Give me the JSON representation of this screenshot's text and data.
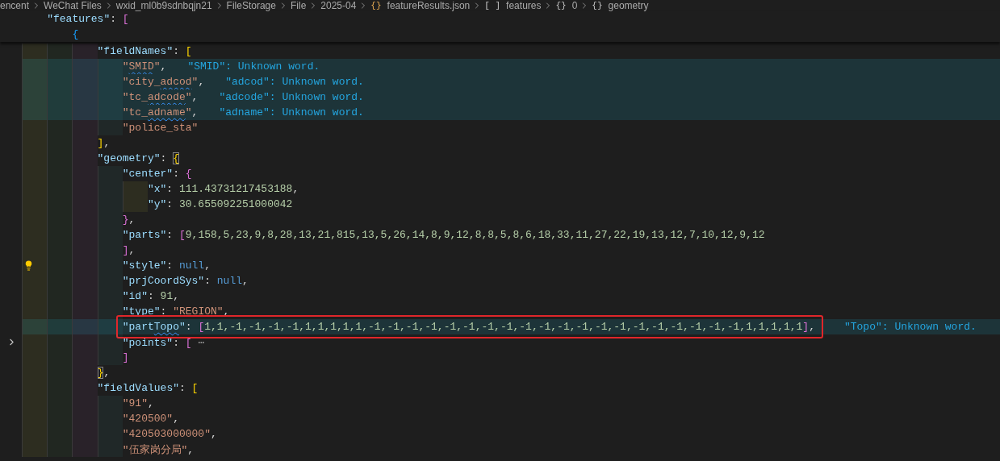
{
  "breadcrumb": [
    {
      "label": "encent",
      "kind": "folder"
    },
    {
      "label": "WeChat Files",
      "kind": "folder"
    },
    {
      "label": "wxid_ml0b9sdnbqjn21",
      "kind": "folder"
    },
    {
      "label": "FileStorage",
      "kind": "folder"
    },
    {
      "label": "File",
      "kind": "folder"
    },
    {
      "label": "2025-04",
      "kind": "folder"
    },
    {
      "label": "featureResults.json",
      "kind": "file",
      "icon": "{}"
    },
    {
      "label": "features",
      "kind": "symbol",
      "icon": "[ ]"
    },
    {
      "label": "0",
      "kind": "symbol",
      "icon": "{}"
    },
    {
      "label": "geometry",
      "kind": "symbol",
      "icon": "{}"
    }
  ],
  "sticky_lines": [
    {
      "tokens": [
        {
          "kind": "key",
          "text": "    \"features\""
        },
        {
          "kind": "punct",
          "text": ": "
        },
        {
          "kind": "bracket-pink",
          "text": "["
        }
      ]
    },
    {
      "tokens": [
        {
          "kind": "bracket-blue",
          "text": "        {"
        }
      ]
    }
  ],
  "lines": [
    {
      "highlighted": false,
      "boxed": false,
      "tokens": [
        {
          "kind": "key",
          "text": "            \"fieldNames\""
        },
        {
          "kind": "punct",
          "text": ": "
        },
        {
          "kind": "bracket-gold",
          "text": "["
        }
      ]
    },
    {
      "highlighted": true,
      "boxed": false,
      "annotation": "\"SMID\": Unknown word.",
      "tokens": [
        {
          "kind": "string",
          "text": "                \""
        },
        {
          "kind": "string-flagged",
          "text": "SMID"
        },
        {
          "kind": "string",
          "text": "\""
        },
        {
          "kind": "punct",
          "text": ","
        }
      ]
    },
    {
      "highlighted": true,
      "boxed": false,
      "annotation": "\"adcod\": Unknown word.",
      "tokens": [
        {
          "kind": "string",
          "text": "                \"city_"
        },
        {
          "kind": "string-flagged",
          "text": "adcod"
        },
        {
          "kind": "string",
          "text": "\""
        },
        {
          "kind": "punct",
          "text": ","
        }
      ]
    },
    {
      "highlighted": true,
      "boxed": false,
      "annotation": "\"adcode\": Unknown word.",
      "tokens": [
        {
          "kind": "string",
          "text": "                \"tc_"
        },
        {
          "kind": "string-flagged",
          "text": "adcode"
        },
        {
          "kind": "string",
          "text": "\""
        },
        {
          "kind": "punct",
          "text": ","
        }
      ]
    },
    {
      "highlighted": true,
      "boxed": false,
      "annotation": "\"adname\": Unknown word.",
      "tokens": [
        {
          "kind": "string",
          "text": "                \"tc_"
        },
        {
          "kind": "string-flagged",
          "text": "adname"
        },
        {
          "kind": "string",
          "text": "\""
        },
        {
          "kind": "punct",
          "text": ","
        }
      ]
    },
    {
      "highlighted": false,
      "boxed": false,
      "tokens": [
        {
          "kind": "string",
          "text": "                \"police_sta\""
        }
      ]
    },
    {
      "highlighted": false,
      "boxed": false,
      "tokens": [
        {
          "kind": "bracket-gold",
          "text": "            ]"
        },
        {
          "kind": "punct",
          "text": ","
        }
      ]
    },
    {
      "highlighted": false,
      "boxed": false,
      "tokens": [
        {
          "kind": "key",
          "text": "            \"geometry\""
        },
        {
          "kind": "punct",
          "text": ": "
        },
        {
          "kind": "bracket-gold-matched",
          "text": "{"
        }
      ]
    },
    {
      "highlighted": false,
      "boxed": false,
      "tokens": [
        {
          "kind": "key",
          "text": "                \"center\""
        },
        {
          "kind": "punct",
          "text": ": "
        },
        {
          "kind": "bracket-pink",
          "text": "{"
        }
      ]
    },
    {
      "highlighted": false,
      "boxed": false,
      "tokens": [
        {
          "kind": "key",
          "text": "                    \"x\""
        },
        {
          "kind": "punct",
          "text": ": "
        },
        {
          "kind": "number",
          "text": "111.43731217453188"
        },
        {
          "kind": "punct",
          "text": ","
        }
      ]
    },
    {
      "highlighted": false,
      "boxed": false,
      "tokens": [
        {
          "kind": "key",
          "text": "                    \"y\""
        },
        {
          "kind": "punct",
          "text": ": "
        },
        {
          "kind": "number",
          "text": "30.655092251000042"
        }
      ]
    },
    {
      "highlighted": false,
      "boxed": false,
      "tokens": [
        {
          "kind": "bracket-pink",
          "text": "                }"
        },
        {
          "kind": "punct",
          "text": ","
        }
      ]
    },
    {
      "highlighted": false,
      "boxed": false,
      "tokens": [
        {
          "kind": "key",
          "text": "                \"parts\""
        },
        {
          "kind": "punct",
          "text": ": "
        },
        {
          "kind": "bracket-pink",
          "text": "["
        },
        {
          "kind": "number",
          "text": "9,158,5,23,9,8,28,13,21,815,13,5,26,14,8,9,12,8,8,5,8,6,18,33,11,27,22,19,13,12,7,10,12,9,12"
        }
      ]
    },
    {
      "highlighted": false,
      "boxed": false,
      "tokens": [
        {
          "kind": "bracket-pink",
          "text": "                ]"
        },
        {
          "kind": "punct",
          "text": ","
        }
      ]
    },
    {
      "highlighted": false,
      "boxed": false,
      "kind": "lightbulb",
      "tokens": [
        {
          "kind": "key",
          "text": "                \"style\""
        },
        {
          "kind": "punct",
          "text": ": "
        },
        {
          "kind": "keyword",
          "text": "null"
        },
        {
          "kind": "punct",
          "text": ","
        }
      ]
    },
    {
      "highlighted": false,
      "boxed": false,
      "tokens": [
        {
          "kind": "key",
          "text": "                \"prjCoordSys\""
        },
        {
          "kind": "punct",
          "text": ": "
        },
        {
          "kind": "keyword",
          "text": "null"
        },
        {
          "kind": "punct",
          "text": ","
        }
      ]
    },
    {
      "highlighted": false,
      "boxed": false,
      "tokens": [
        {
          "kind": "key",
          "text": "                \"id\""
        },
        {
          "kind": "punct",
          "text": ": "
        },
        {
          "kind": "number",
          "text": "91"
        },
        {
          "kind": "punct",
          "text": ","
        }
      ]
    },
    {
      "highlighted": false,
      "boxed": false,
      "tokens": [
        {
          "kind": "key",
          "text": "                \"type\""
        },
        {
          "kind": "punct",
          "text": ": "
        },
        {
          "kind": "string",
          "text": "\"REGION\""
        },
        {
          "kind": "punct",
          "text": ","
        }
      ]
    },
    {
      "highlighted": true,
      "boxed": true,
      "annotation": "\"Topo\": Unknown word.",
      "tokens": [
        {
          "kind": "key",
          "text": "                \"part"
        },
        {
          "kind": "key-flagged",
          "text": "Topo"
        },
        {
          "kind": "key",
          "text": "\""
        },
        {
          "kind": "punct",
          "text": ": "
        },
        {
          "kind": "bracket-pink",
          "text": "["
        },
        {
          "kind": "number",
          "text": "1,1,-1,-1,-1,-1,1,1,1,1,1,-1,-1,-1,-1,-1,-1,-1,-1,-1,-1,-1,-1,-1,-1,-1,-1,-1,-1,-1,-1,1,1,1,1,1"
        },
        {
          "kind": "bracket-pink",
          "text": "]"
        },
        {
          "kind": "punct",
          "text": ","
        }
      ]
    },
    {
      "highlighted": false,
      "boxed": false,
      "kind": "folded",
      "tokens": [
        {
          "kind": "key",
          "text": "                \"points\""
        },
        {
          "kind": "punct",
          "text": ": "
        },
        {
          "kind": "bracket-pink",
          "text": "["
        },
        {
          "kind": "fold-ellipsis",
          "text": "⋯"
        }
      ]
    },
    {
      "highlighted": false,
      "boxed": false,
      "tokens": [
        {
          "kind": "bracket-pink",
          "text": "                ]"
        }
      ]
    },
    {
      "highlighted": false,
      "boxed": false,
      "tokens": [
        {
          "kind": "bracket-gold-matched",
          "text": "            }"
        },
        {
          "kind": "punct",
          "text": ","
        }
      ]
    },
    {
      "highlighted": false,
      "boxed": false,
      "tokens": [
        {
          "kind": "key",
          "text": "            \"fieldValues\""
        },
        {
          "kind": "punct",
          "text": ": "
        },
        {
          "kind": "bracket-gold",
          "text": "["
        }
      ]
    },
    {
      "highlighted": false,
      "boxed": false,
      "tokens": [
        {
          "kind": "string",
          "text": "                \"91\""
        },
        {
          "kind": "punct",
          "text": ","
        }
      ]
    },
    {
      "highlighted": false,
      "boxed": false,
      "tokens": [
        {
          "kind": "string",
          "text": "                \"420500\""
        },
        {
          "kind": "punct",
          "text": ","
        }
      ]
    },
    {
      "highlighted": false,
      "boxed": false,
      "tokens": [
        {
          "kind": "string",
          "text": "                \"420503000000\""
        },
        {
          "kind": "punct",
          "text": ","
        }
      ]
    },
    {
      "highlighted": false,
      "boxed": false,
      "tokens": [
        {
          "kind": "string",
          "text": "                \"伍家岗分局\""
        },
        {
          "kind": "punct",
          "text": ","
        }
      ]
    }
  ]
}
